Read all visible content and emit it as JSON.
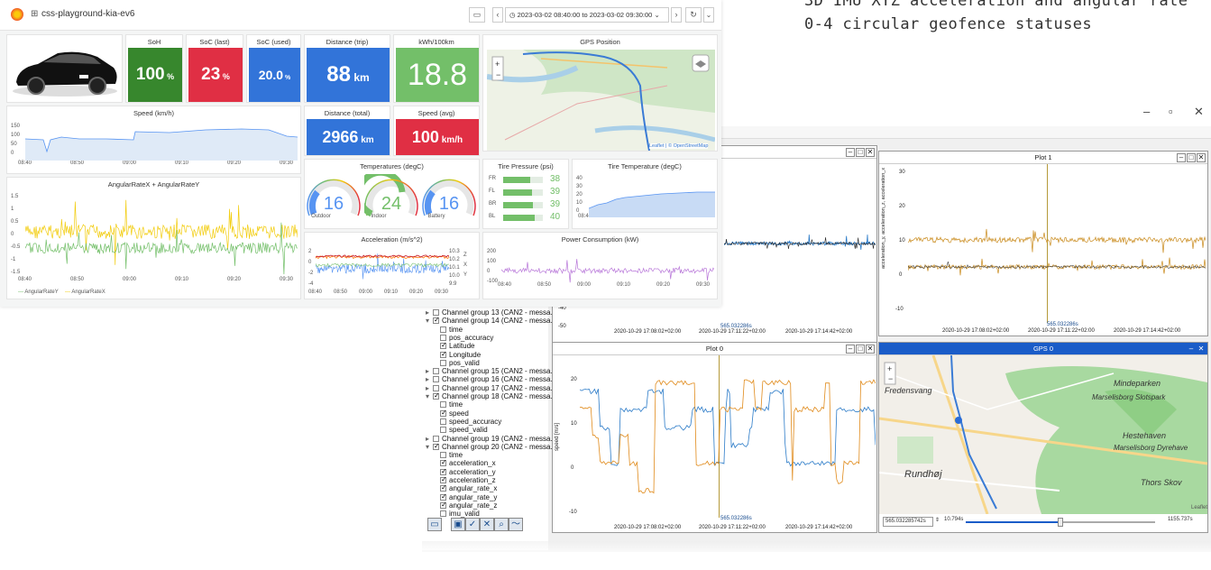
{
  "notes": {
    "line1": "3D IMU XYZ acceleration and angular rate",
    "line2": "0-4 circular geofence statuses"
  },
  "dashboard": {
    "title": "css-playground-kia-ev6",
    "time_range": "2023-03-02 08:40:00 to 2023-03-02 09:30:00",
    "soh": {
      "label": "SoH",
      "value": "100",
      "unit": "%",
      "color": "#37872d"
    },
    "soc_last": {
      "label": "SoC (last)",
      "value": "23",
      "unit": "%",
      "color": "#e02f44"
    },
    "soc_used": {
      "label": "SoC (used)",
      "value": "20.0",
      "unit": "%",
      "color": "#3274d9"
    },
    "dist_trip": {
      "label": "Distance (trip)",
      "value": "88",
      "unit": "km",
      "color": "#3274d9"
    },
    "kwh": {
      "label": "kWh/100km",
      "value": "18.8",
      "color": "#73bf69"
    },
    "dist_total": {
      "label": "Distance (total)",
      "value": "2966",
      "unit": "km",
      "color": "#3274d9"
    },
    "speed_avg": {
      "label": "Speed (avg)",
      "value": "100",
      "unit": "km/h",
      "color": "#e02f44"
    },
    "gps_title": "GPS Position",
    "map_attr": "Leaflet | © OpenStreetMap",
    "speed_panel": {
      "title": "Speed (km/h)",
      "yticks": [
        "150",
        "100",
        "50",
        "0"
      ],
      "xticks": [
        "08:40",
        "08:50",
        "09:00",
        "09:10",
        "09:20",
        "09:30"
      ]
    },
    "angular_panel": {
      "title": "AngularRateX + AngularRateY",
      "yticks": [
        "1.5",
        "1",
        "0.5",
        "0",
        "-0.5",
        "-1",
        "-1.5"
      ],
      "xticks": [
        "08:40",
        "08:50",
        "09:00",
        "09:10",
        "09:20",
        "09:30"
      ],
      "legend": [
        "AngularRateY",
        "AngularRateX"
      ]
    },
    "temps": {
      "title": "Temperatures (degC)",
      "gauges": [
        {
          "value": "16",
          "label": "Outdoor"
        },
        {
          "value": "24",
          "label": "Indoor"
        },
        {
          "value": "16",
          "label": "Battery"
        }
      ]
    },
    "tire_pressure": {
      "title": "Tire Pressure (psi)",
      "rows": [
        {
          "name": "FR",
          "value": "38",
          "fill": 0.68
        },
        {
          "name": "FL",
          "value": "39",
          "fill": 0.72
        },
        {
          "name": "BR",
          "value": "39",
          "fill": 0.75
        },
        {
          "name": "BL",
          "value": "40",
          "fill": 0.8
        }
      ]
    },
    "tire_temp": {
      "title": "Tire Temperature (degC)",
      "yticks": [
        "40",
        "30",
        "20",
        "10",
        "0"
      ],
      "xticks": [
        "08:40",
        "08:50",
        "09:00",
        "09:10",
        "09:20",
        "09:30"
      ]
    },
    "accel": {
      "title": "Acceleration (m/s^2)",
      "yticks": [
        "2",
        "0",
        "-2",
        "-4"
      ],
      "xticks": [
        "08:40",
        "08:50",
        "09:00",
        "09:10",
        "09:20",
        "09:30"
      ],
      "legend_vals": [
        "10.3",
        "10.2",
        "10.1",
        "10.0",
        "9.9"
      ],
      "legend_labels": [
        "Z",
        "X",
        "Y"
      ]
    },
    "power": {
      "title": "Power Consumption (kW)",
      "yticks": [
        "200",
        "100",
        "0",
        "-100"
      ],
      "xticks": [
        "08:40",
        "08:50",
        "09:00",
        "09:10",
        "09:20",
        "09:30"
      ]
    }
  },
  "desktop": {
    "tree": [
      {
        "text": "Channel group 13 (CAN2 - messa...",
        "indent": 0,
        "toggle": "▸",
        "checked": false
      },
      {
        "text": "Channel group 14 (CAN2 - messa...",
        "indent": 0,
        "toggle": "▾",
        "checked": true
      },
      {
        "text": "time",
        "indent": 1,
        "checked": false
      },
      {
        "text": "pos_accuracy",
        "indent": 1,
        "checked": false
      },
      {
        "text": "Latitude",
        "indent": 1,
        "checked": true
      },
      {
        "text": "Longitude",
        "indent": 1,
        "checked": true
      },
      {
        "text": "pos_valid",
        "indent": 1,
        "checked": false
      },
      {
        "text": "Channel group 15 (CAN2 - messa...",
        "indent": 0,
        "toggle": "▸",
        "checked": false
      },
      {
        "text": "Channel group 16 (CAN2 - messa...",
        "indent": 0,
        "toggle": "▸",
        "checked": false
      },
      {
        "text": "Channel group 17 (CAN2 - messa...",
        "indent": 0,
        "toggle": "▸",
        "checked": false
      },
      {
        "text": "Channel group 18 (CAN2 - messa...",
        "indent": 0,
        "toggle": "▾",
        "checked": true
      },
      {
        "text": "time",
        "indent": 1,
        "checked": false
      },
      {
        "text": "speed",
        "indent": 1,
        "checked": true
      },
      {
        "text": "speed_accuracy",
        "indent": 1,
        "checked": false
      },
      {
        "text": "speed_valid",
        "indent": 1,
        "checked": false
      },
      {
        "text": "Channel group 19 (CAN2 - messa...",
        "indent": 0,
        "toggle": "▸",
        "checked": false
      },
      {
        "text": "Channel group 20 (CAN2 - messa...",
        "indent": 0,
        "toggle": "▾",
        "checked": true
      },
      {
        "text": "time",
        "indent": 1,
        "checked": false
      },
      {
        "text": "acceleration_x",
        "indent": 1,
        "checked": true
      },
      {
        "text": "acceleration_y",
        "indent": 1,
        "checked": true
      },
      {
        "text": "acceleration_z",
        "indent": 1,
        "checked": true
      },
      {
        "text": "angular_rate_x",
        "indent": 1,
        "checked": true
      },
      {
        "text": "angular_rate_y",
        "indent": 1,
        "checked": true
      },
      {
        "text": "angular_rate_z",
        "indent": 1,
        "checked": true
      },
      {
        "text": "imu_valid",
        "indent": 1,
        "checked": false
      }
    ],
    "plot1": {
      "title": "Plot 1",
      "ylabel": "acceleration_y, acceleration_z, acceleration_x",
      "yticks": [
        "30",
        "20",
        "10",
        "0",
        "-10"
      ],
      "cursor": "565.032286s",
      "xticks": [
        "2020-10-29 17:08:02+02:00",
        "2020-10-29 17:11:22+02:00",
        "2020-10-29 17:14:42+02:00"
      ]
    },
    "plot_top": {
      "yticks": [
        "-40",
        "-50"
      ],
      "cursor": "565.032286s",
      "xticks": [
        "2020-10-29 17:08:02+02:00",
        "2020-10-29 17:11:22+02:00",
        "2020-10-29 17:14:42+02:00"
      ]
    },
    "plot0": {
      "title": "Plot 0",
      "ylabel": "speed [m/s]",
      "yticks": [
        "20",
        "10",
        "0",
        "-10"
      ],
      "cursor": "565.032286s",
      "xticks": [
        "2020-10-29 17:08:02+02:00",
        "2020-10-29 17:11:22+02:00",
        "2020-10-29 17:14:42+02:00"
      ]
    },
    "gps": {
      "title": "GPS 0",
      "labels": [
        "Fredensvang",
        "Mindeparken",
        "Marselisborg Slotspark",
        "Hestehaven",
        "Marselisborg Dyrehave",
        "Rundhøj",
        "Thors Skov"
      ],
      "time_value": "565.032285742s",
      "step_value": "10.794s",
      "end_value": "1155.737s",
      "attr": "Leaflet"
    }
  }
}
